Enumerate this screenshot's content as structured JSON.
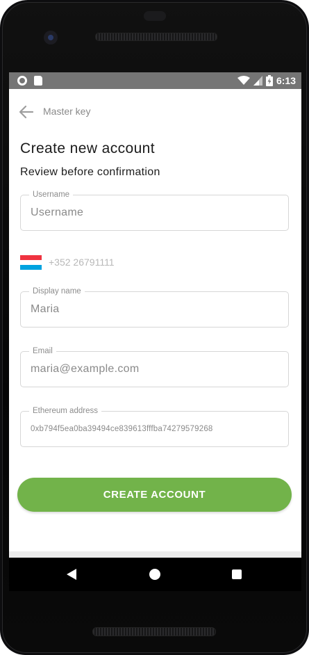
{
  "status_bar": {
    "time": "6:13",
    "left_icons": [
      "circle-notification-icon",
      "sd-card-icon"
    ],
    "right_icons": [
      "wifi-icon",
      "signal-icon",
      "battery-charging-icon"
    ]
  },
  "app_bar": {
    "back_icon": "arrow-left-icon",
    "title": "Master key"
  },
  "header": {
    "title": "Create new account",
    "subtitle": "Review before confirmation"
  },
  "form": {
    "username": {
      "label": "Username",
      "placeholder": "Username",
      "value": ""
    },
    "phone": {
      "flag_icon": "luxembourg-flag-icon",
      "flag_colors": [
        "#EF3340",
        "#FFFFFF",
        "#00A3E0"
      ],
      "value": "+352 26791111"
    },
    "display_name": {
      "label": "Display name",
      "value": "Maria"
    },
    "email": {
      "label": "Email",
      "value": "maria@example.com"
    },
    "ethereum_address": {
      "label": "Ethereum address",
      "value": "0xb794f5ea0ba39494ce839613fffba74279579268"
    }
  },
  "actions": {
    "create_label": "CREATE ACCOUNT"
  },
  "nav_bar": {
    "icons": [
      "nav-back-icon",
      "nav-home-icon",
      "nav-recents-icon"
    ]
  },
  "colors": {
    "primary_button": "#72B34A",
    "status_bar": "#757575"
  }
}
